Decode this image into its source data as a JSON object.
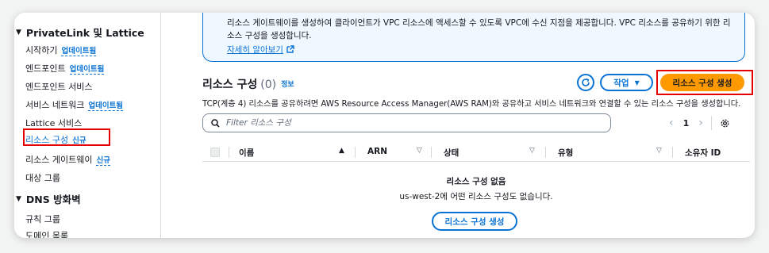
{
  "sidebar": {
    "sections": [
      {
        "title": "PrivateLink 및 Lattice"
      },
      {
        "title": "DNS 방화벽"
      }
    ],
    "items": [
      {
        "label": "시작하기",
        "badge": "업데이트됨"
      },
      {
        "label": "엔드포인트",
        "badge": "업데이트됨"
      },
      {
        "label": "엔드포인트 서비스",
        "badge": ""
      },
      {
        "label": "서비스 네트워크",
        "badge": "업데이트됨"
      },
      {
        "label": "Lattice 서비스",
        "badge": ""
      },
      {
        "label": "리소스 구성",
        "badge": "신규"
      },
      {
        "label": "리소스 게이트웨이",
        "badge": "신규"
      },
      {
        "label": "대상 그룹",
        "badge": ""
      },
      {
        "label": "규칙 그룹",
        "badge": ""
      },
      {
        "label": "도메인 목록",
        "badge": ""
      }
    ]
  },
  "info_box": {
    "text": "리소스 게이트웨이를 생성하여 클라이언트가 VPC 리소스에 액세스할 수 있도록 VPC에 수신 지점을 제공합니다. VPC 리소스를 공유하기 위한 리소스 구성을 생성합니다.",
    "link": "자세히 알아보기"
  },
  "header": {
    "title": "리소스 구성",
    "count": "(0)",
    "info": "정보",
    "actions_label": "작업",
    "create_label": "리소스 구성 생성",
    "description": "TCP(계층 4) 리소스를 공유하려면 AWS Resource Access Manager(AWS RAM)와 공유하고 서비스 네트워크와 연결할 수 있는 리소스 구성을 생성합니다."
  },
  "search": {
    "placeholder": "Filter 리소스 구성"
  },
  "pagination": {
    "current_page": "1"
  },
  "table": {
    "columns": [
      "이름",
      "ARN",
      "상태",
      "유형",
      "소유자 ID"
    ]
  },
  "empty_state": {
    "title": "리소스 구성 없음",
    "subtitle": "us-west-2에 어떤 리소스 구성도 없습니다.",
    "button": "리소스 구성 생성"
  },
  "colors": {
    "accent": "#0972d3",
    "primary_button": "#ff9900",
    "highlight": "#e60000"
  }
}
